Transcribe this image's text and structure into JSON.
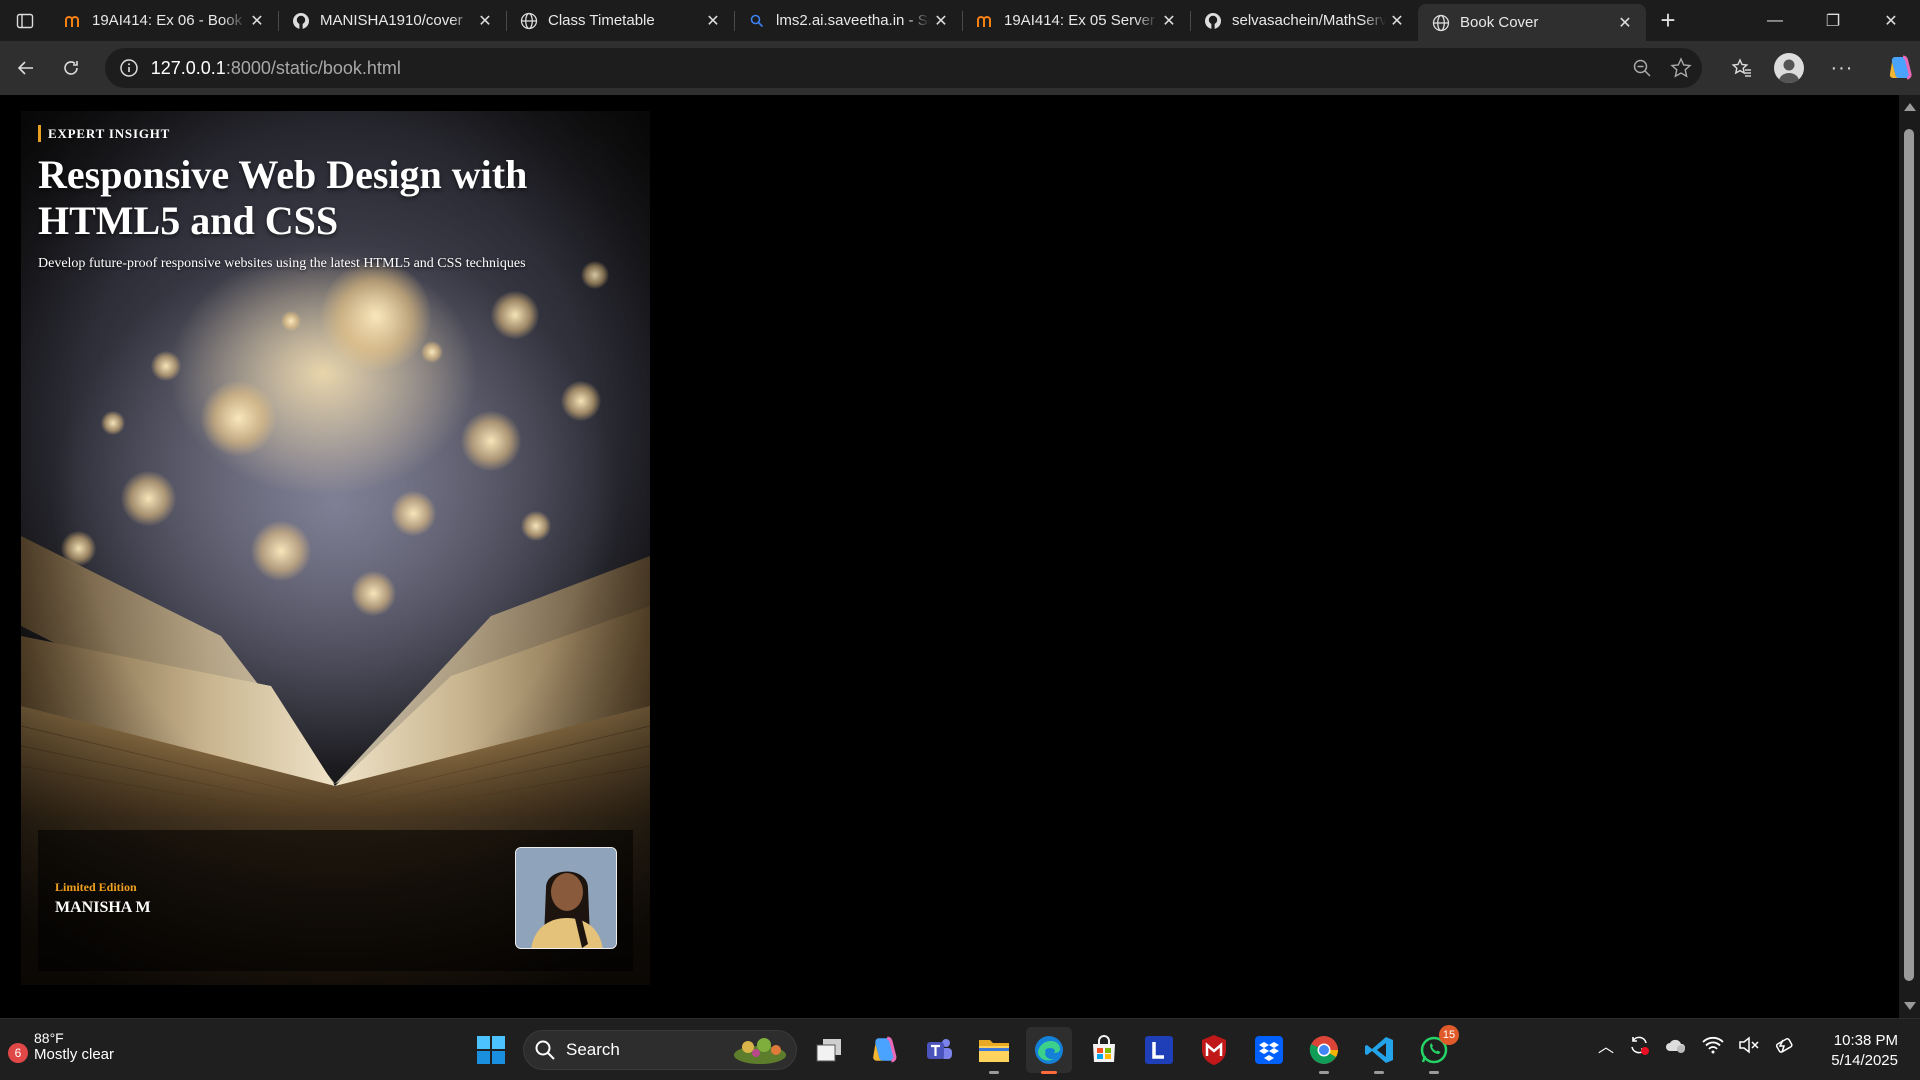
{
  "tabs": [
    {
      "title": "19AI414: Ex 06 - Book F",
      "icon": "moodle-icon",
      "active": false
    },
    {
      "title": "MANISHA1910/cover",
      "icon": "github-icon",
      "active": false
    },
    {
      "title": "Class Timetable",
      "icon": "globe-icon",
      "active": false
    },
    {
      "title": "lms2.ai.saveetha.in - Se",
      "icon": "search-icon",
      "active": false
    },
    {
      "title": "19AI414: Ex 05 Server S",
      "icon": "moodle-icon",
      "active": false
    },
    {
      "title": "selvasachein/MathServ",
      "icon": "github-icon",
      "active": false
    },
    {
      "title": "Book Cover",
      "icon": "globe-icon",
      "active": true
    }
  ],
  "address": {
    "host": "127.0.0.1",
    "path": ":8000/static/book.html"
  },
  "cover": {
    "series": "EXPERT INSIGHT",
    "title_line1": "Responsive Web Design with",
    "title_line2": "HTML5 and CSS",
    "subtitle": "Develop future-proof responsive websites using the latest HTML5 and CSS techniques",
    "edition": "Limited Edition",
    "author": "MANISHA M",
    "accent_color": "#e8a020"
  },
  "taskbar": {
    "weather_badge": "6",
    "temperature": "88°F",
    "condition": "Mostly clear",
    "search_label": "Search",
    "whatsapp_badge": "15",
    "time": "10:38 PM",
    "date": "5/14/2025"
  }
}
